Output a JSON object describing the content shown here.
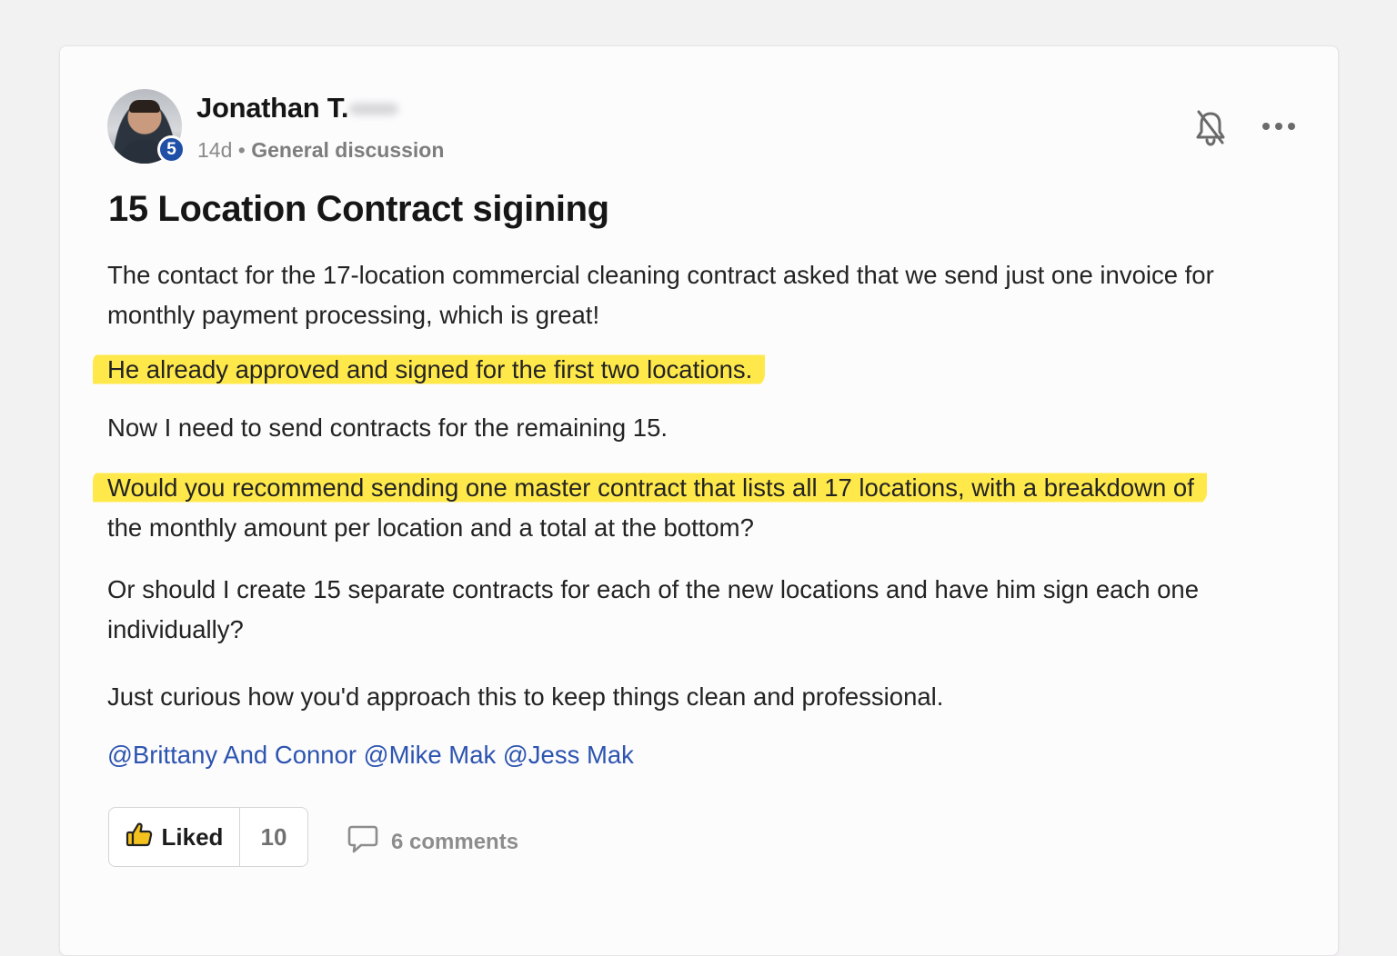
{
  "post": {
    "author": "Jonathan T.",
    "level": "5",
    "age": "14d",
    "separator": "•",
    "category": "General discussion",
    "title": "15 Location Contract sigining",
    "paragraphs": [
      "The contact for the 17-location commercial cleaning contract asked that we send just one invoice for monthly payment processing, which is great!",
      "He already approved and signed for the first two locations.",
      "Now I need to send contracts for the remaining 15.",
      "Would you recommend sending one master contract that lists all 17 locations, with a breakdown of",
      "the monthly amount per location and a total at the bottom?",
      "Or should I create 15 separate contracts for each of the new locations and have him sign each one individually?",
      "Just curious how you'd approach this to keep things clean and professional."
    ],
    "mentions": "@Brittany And Connor @Mike Mak @Jess Mak"
  },
  "actions": {
    "like_label": "Liked",
    "like_count": "10",
    "comments_label": "6 comments"
  },
  "icons": {
    "bell": "bell-off-icon",
    "more": "more-icon",
    "like": "thumbs-up-icon",
    "comment": "comment-icon"
  },
  "colors": {
    "highlight": "#ffe94a",
    "mention": "#2c54b0",
    "badge": "#1f4fa6"
  }
}
